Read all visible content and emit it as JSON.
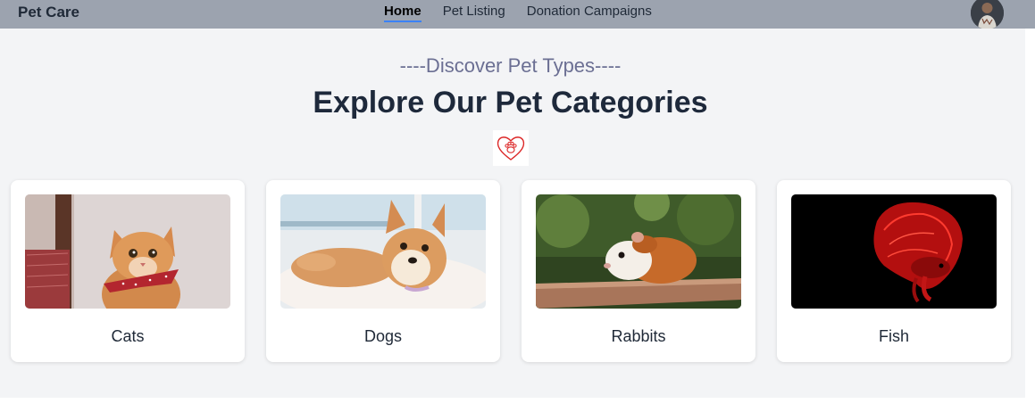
{
  "navbar": {
    "brand": "Pet Care",
    "links": [
      {
        "label": "Home",
        "active": true
      },
      {
        "label": "Pet Listing",
        "active": false
      },
      {
        "label": "Donation Campaigns",
        "active": false
      }
    ]
  },
  "section": {
    "subtitle": "----Discover Pet Types----",
    "title": "Explore Our Pet Categories"
  },
  "categories": [
    {
      "label": "Cats",
      "icon": "cat-photo"
    },
    {
      "label": "Dogs",
      "icon": "dog-photo"
    },
    {
      "label": "Rabbits",
      "icon": "guinea-pig-photo"
    },
    {
      "label": "Fish",
      "icon": "betta-fish-photo"
    }
  ],
  "colors": {
    "navbar_bg": "#9ca3af",
    "section_bg": "#f3f4f6",
    "subtitle": "#6b6f93",
    "title": "#1e293b",
    "active_underline": "#3b82f6",
    "heart": "#dc2626"
  }
}
